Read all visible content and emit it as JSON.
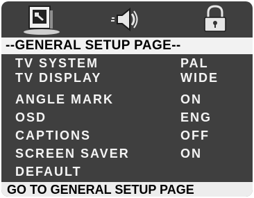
{
  "tabs": [
    {
      "name": "general-setup",
      "icon": "monitor-icon",
      "active": true
    },
    {
      "name": "audio-setup",
      "icon": "speaker-icon",
      "active": false
    },
    {
      "name": "preference",
      "icon": "lock-icon",
      "active": false
    }
  ],
  "header": {
    "title": "--GENERAL SETUP PAGE--"
  },
  "menu": {
    "items": [
      {
        "label": "TV SYSTEM",
        "value": "PAL"
      },
      {
        "label": "TV DISPLAY",
        "value": "WIDE"
      },
      {
        "label": "ANGLE MARK",
        "value": "ON"
      },
      {
        "label": "OSD",
        "value": "ENG"
      },
      {
        "label": "CAPTIONS",
        "value": "OFF"
      },
      {
        "label": "SCREEN SAVER",
        "value": "ON"
      },
      {
        "label": "DEFAULT",
        "value": ""
      }
    ]
  },
  "status": {
    "text": "GO TO GENERAL SETUP PAGE"
  },
  "colors": {
    "background": "#3f3f3f",
    "highlight": "#f2f2f2",
    "text": "#f4f4f4"
  }
}
